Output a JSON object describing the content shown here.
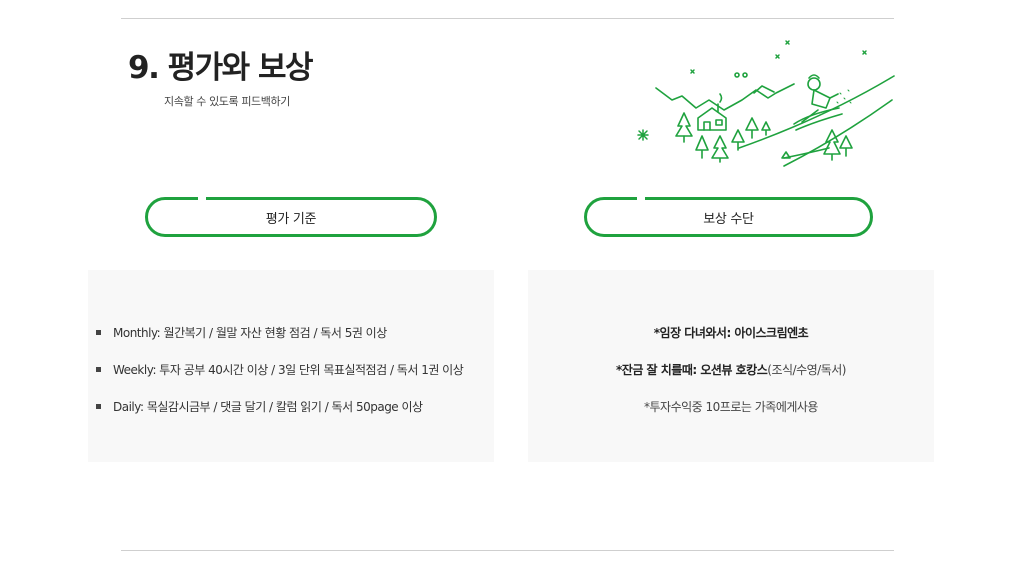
{
  "slide": {
    "title": "9. 평가와 보상",
    "subtitle": "지속할 수 있도록 피드백하기"
  },
  "illustration": {
    "icon": "winter-sledding-illustration",
    "color": "#1fa23e"
  },
  "evaluation": {
    "header": "평가 기준",
    "items": [
      "Monthly: 월간복기 / 월말 자산 현황 점검 / 독서 5권 이상",
      "Weekly: 투자 공부 40시간 이상 / 3일 단위 목표실적점검 / 독서 1권 이상",
      "Daily: 목실감시금부 / 댓글 달기 / 칼럼 읽기 / 독서 50page 이상"
    ]
  },
  "reward": {
    "header": "보상 수단",
    "line1": "*임장 다녀와서: 아이스크림엔초",
    "line2_bold": "*잔금 잘 치를때: 오션뷰 호캉스",
    "line2_rest": " (조식/수영/독서)",
    "line3": "*투자수익중 10프로는 가족에게사용"
  },
  "colors": {
    "accent": "#1fa23e",
    "panel_bg": "#f8f8f8",
    "rule": "#cfcfcf"
  }
}
